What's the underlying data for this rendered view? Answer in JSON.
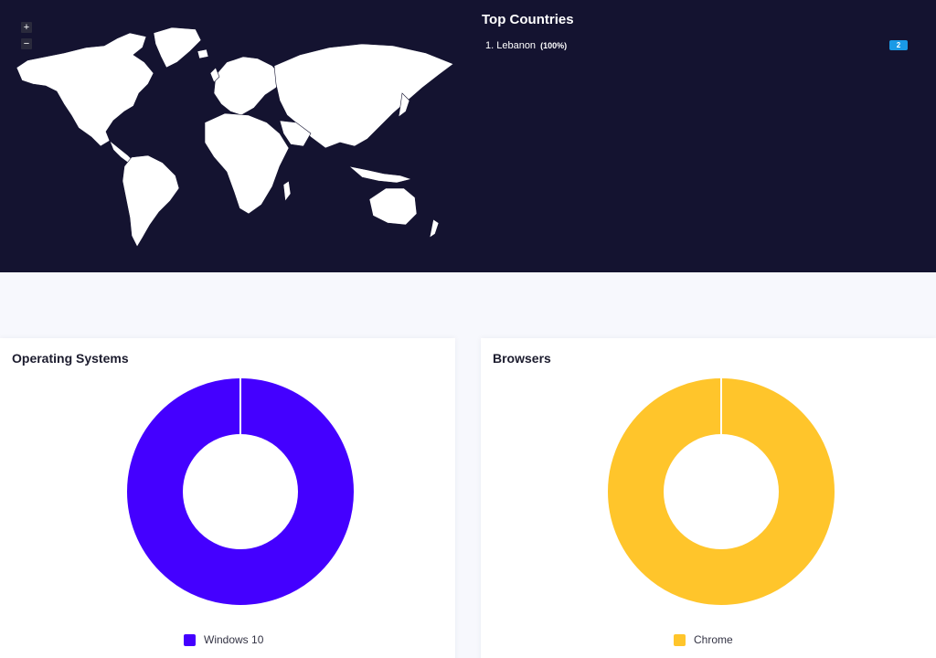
{
  "map": {
    "zoom_in_label": "+",
    "zoom_out_label": "−"
  },
  "top_countries": {
    "title": "Top Countries",
    "items": [
      {
        "rank_name": "1. Lebanon",
        "percent": "(100%)",
        "count": "2"
      }
    ]
  },
  "operating_systems": {
    "title": "Operating Systems",
    "chart_data": {
      "type": "pie",
      "categories": [
        "Windows 10"
      ],
      "values": [
        100
      ],
      "colors": [
        "#4400ff"
      ],
      "legend": "bottom"
    }
  },
  "browsers": {
    "title": "Browsers",
    "chart_data": {
      "type": "pie",
      "categories": [
        "Chrome"
      ],
      "values": [
        100
      ],
      "colors": [
        "#ffc52b"
      ],
      "legend": "bottom"
    }
  }
}
